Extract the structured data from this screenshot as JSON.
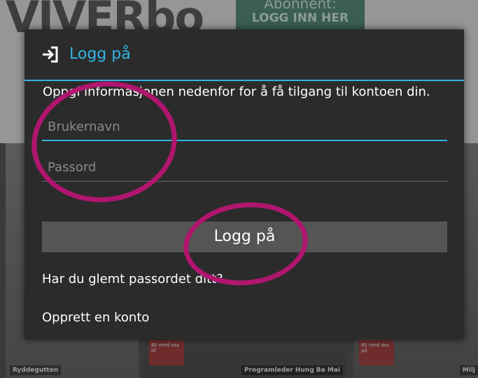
{
  "background": {
    "masthead_text": "VIVERbo",
    "cta_line1": "Abonnent:",
    "cta_line2": "LOGG INN HER",
    "thumbnails": [
      {
        "caption": "Ryddegutten",
        "badge": "Bli med oss til"
      },
      {
        "caption": "Programleder Hung Ba Mai",
        "badge": "Bli med oss til"
      },
      {
        "caption": "Milj",
        "badge": "Bli med oss på"
      }
    ]
  },
  "dialog": {
    "icon": "login-arrow-icon",
    "title": "Logg på",
    "instructions": "Oppgi informasjonen nedenfor for å få tilgang til kontoen din.",
    "username": {
      "placeholder": "Brukernavn",
      "value": ""
    },
    "password": {
      "placeholder": "Passord",
      "value": ""
    },
    "login_button_label": "Logg på",
    "forgot_password_link": "Har du glemt passordet ditt?",
    "create_account_link": "Opprett en konto"
  },
  "colors": {
    "accent": "#33b5e5",
    "dialog_bg": "#2b2b2b",
    "button_bg": "#555555",
    "annotation": "#b0166e"
  }
}
